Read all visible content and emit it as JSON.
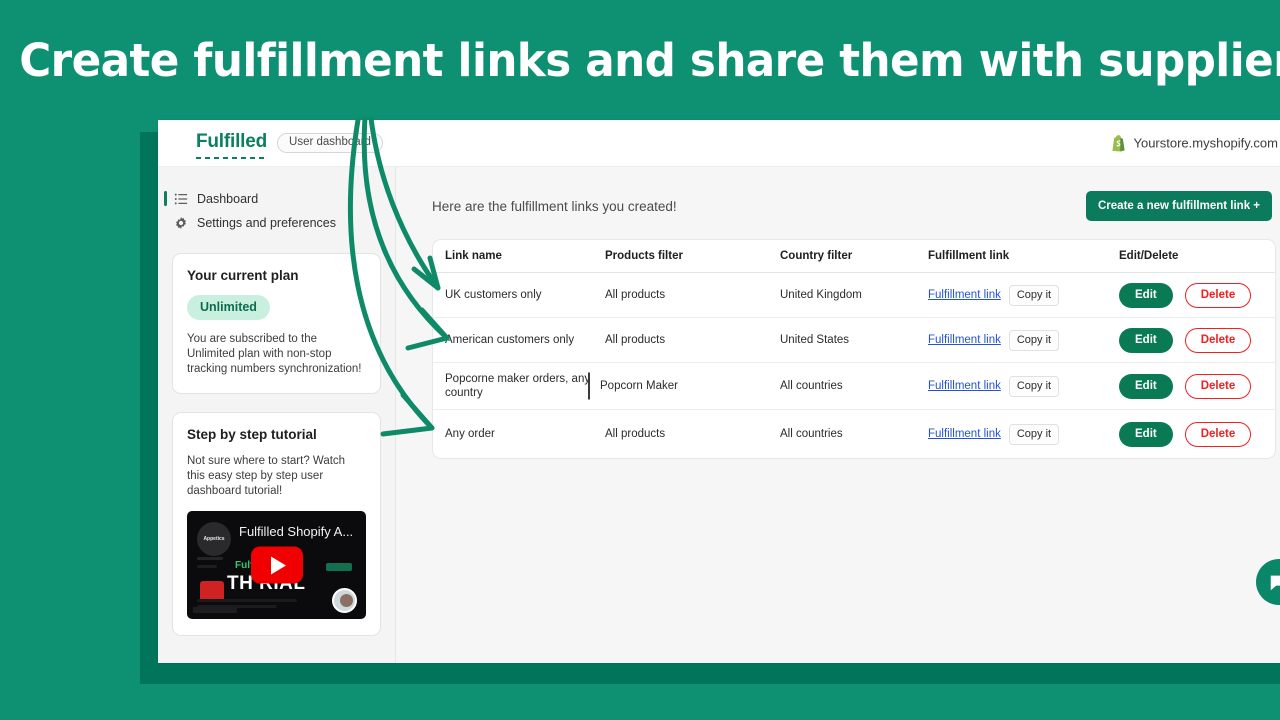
{
  "hero": {
    "title": "Create fulfillment links and share them with suppliers"
  },
  "appbar": {
    "brand": "Fulfilled",
    "badge": "User dashboard",
    "store": "Yourstore.myshopify.com",
    "shopify_icon": "shopify-bag-icon"
  },
  "sidebar": {
    "nav": [
      {
        "label": "Dashboard",
        "icon": "list-icon",
        "active": true
      },
      {
        "label": "Settings and preferences",
        "icon": "gear-icon",
        "active": false
      }
    ],
    "plan_card": {
      "title": "Your current plan",
      "chip": "Unlimited",
      "description": "You are subscribed to the Unlimited plan with non-stop tracking numbers synchronization!"
    },
    "tutorial_card": {
      "title": "Step by step tutorial",
      "description": "Not sure where to start? Watch this easy step by step user dashboard tutorial!",
      "video": {
        "title": "Fulfilled Shopify A...",
        "channel": "Appetics",
        "overlay_green": "Fulf",
        "overlay_app": "App",
        "overlay_big": "TH      RIAL",
        "play_icon": "play-button-icon"
      }
    }
  },
  "main": {
    "heading": "Here are the fulfillment links you created!",
    "create_button": "Create a new fulfillment link +",
    "table": {
      "columns": [
        "Link name",
        "Products filter",
        "Country filter",
        "Fulfillment link",
        "Edit/Delete"
      ],
      "rows": [
        {
          "link_name": "UK customers only",
          "products_filter": "All products",
          "country_filter": "United Kingdom",
          "fulfillment_link": "Fulfillment link",
          "copy_label": "Copy it",
          "edit_label": "Edit",
          "delete_label": "Delete",
          "has_separator": false
        },
        {
          "link_name": "American customers only",
          "products_filter": "All products",
          "country_filter": "United States",
          "fulfillment_link": "Fulfillment link",
          "copy_label": "Copy it",
          "edit_label": "Edit",
          "delete_label": "Delete",
          "has_separator": false
        },
        {
          "link_name": "Popcorne maker orders, any country",
          "products_filter": "Popcorn Maker",
          "country_filter": "All countries",
          "fulfillment_link": "Fulfillment link",
          "copy_label": "Copy it",
          "edit_label": "Edit",
          "delete_label": "Delete",
          "has_separator": true
        },
        {
          "link_name": "Any order",
          "products_filter": "All products",
          "country_filter": "All countries",
          "fulfillment_link": "Fulfillment link",
          "copy_label": "Copy it",
          "edit_label": "Edit",
          "delete_label": "Delete",
          "has_separator": false
        }
      ]
    },
    "chat_icon": "chat-bubble-icon"
  },
  "colors": {
    "background_green": "#0e9172",
    "shadow_green": "#00755c",
    "brand_green": "#0a8060",
    "button_green": "#0c7a5c",
    "edit_green": "#0a7a55",
    "delete_red": "#f02020",
    "link_blue": "#2352d8",
    "chip_bg": "#c9f0df",
    "arrow_green": "#0f8a68"
  }
}
